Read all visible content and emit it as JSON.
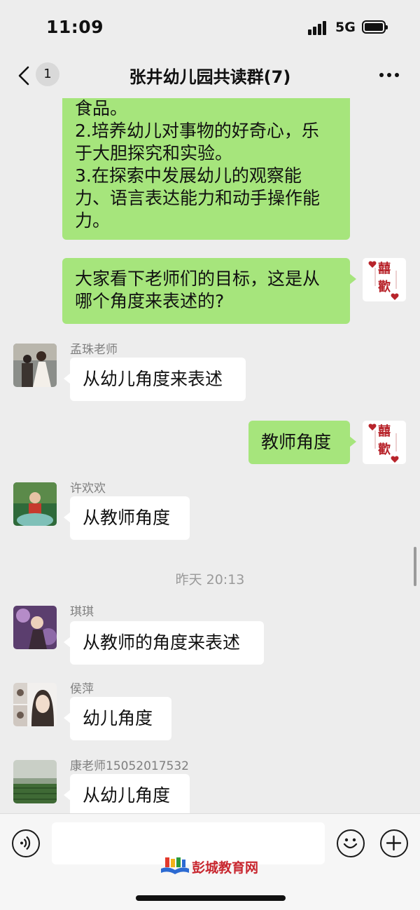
{
  "status": {
    "time": "11:09",
    "network": "5G"
  },
  "nav": {
    "unread_count": "1",
    "title": "张井幼儿园共读群(7)"
  },
  "messages": [
    {
      "side": "me",
      "lines": [
        "食品。",
        "2.培养幼儿对事物的好奇心，乐",
        "于大胆探究和实验。",
        "3.在探索中发展幼儿的观察能",
        "力、语言表达能力和动手操作能",
        "力。"
      ]
    },
    {
      "side": "me",
      "lines": [
        "大家看下老师们的目标，这是从",
        "哪个角度来表述的?"
      ]
    },
    {
      "side": "other",
      "sender": "孟珠老师",
      "text": "从幼儿角度来表述"
    },
    {
      "side": "me",
      "text": "教师角度"
    },
    {
      "side": "other",
      "sender": "许欢欢",
      "text": "从教师角度"
    },
    {
      "timestamp": "昨天 20:13"
    },
    {
      "side": "other",
      "sender": "琪琪",
      "text": "从教师的角度来表述"
    },
    {
      "side": "other",
      "sender": "侯萍",
      "text": "幼儿角度"
    },
    {
      "side": "other",
      "sender": "康老师15052017532",
      "text": "从幼儿角度"
    }
  ],
  "my_avatar": {
    "chars": [
      "囍",
      "歡"
    ],
    "icon": "heart-icon"
  },
  "input": {
    "voice_icon": "voice-icon",
    "emoji_icon": "emoji-icon",
    "plus_icon": "plus-icon",
    "text": ""
  },
  "watermark": {
    "text": "彭城教育网"
  },
  "colors": {
    "my_bubble": "#a6e57c",
    "other_bubble": "#ffffff",
    "background": "#ededed",
    "avatar_red": "#b8242b"
  }
}
